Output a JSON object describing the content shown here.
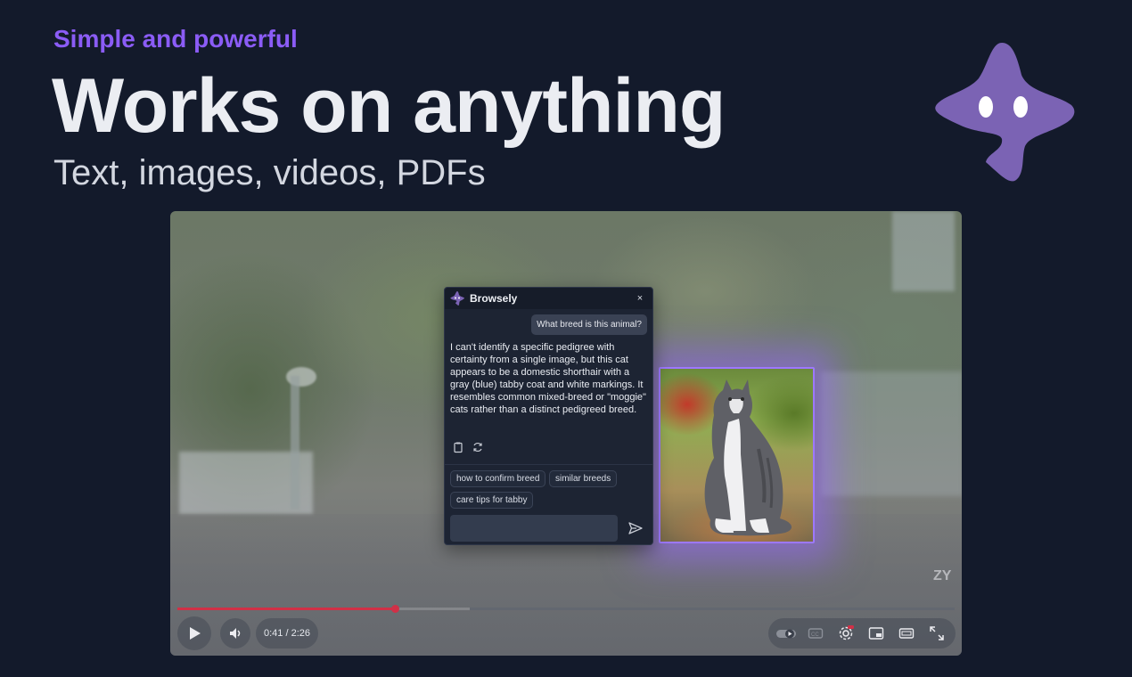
{
  "hero": {
    "eyebrow": "Simple and powerful",
    "headline": "Works on anything",
    "subhead": "Text, images, videos, PDFs"
  },
  "colors": {
    "accent": "#8b5cf6",
    "mascot": "#7b63b4",
    "progress": "#d13047",
    "glow": "#9d78ff"
  },
  "assistant": {
    "title": "Browsely",
    "close_label": "×",
    "user_message": "What breed is this animal?",
    "bot_message": "I can't identify a specific pedigree with certainty from a single image, but this cat appears to be a domestic shorthair with a gray (blue) tabby coat and white markings. It resembles common mixed-breed or \"moggie\" cats rather than a distinct pedigreed breed.",
    "actions": [
      "clipboard-icon",
      "refresh-icon"
    ],
    "suggestions": [
      "how to confirm breed",
      "similar breeds",
      "care tips for tabby"
    ],
    "input_value": "",
    "input_placeholder": ""
  },
  "player": {
    "time": "0:41 / 2:26",
    "progress_fraction": 0.28,
    "watermark": "ZY",
    "right_icons": [
      "autoplay-toggle-icon",
      "captions-icon",
      "settings-icon",
      "miniplayer-icon",
      "theater-icon",
      "fullscreen-icon"
    ]
  }
}
